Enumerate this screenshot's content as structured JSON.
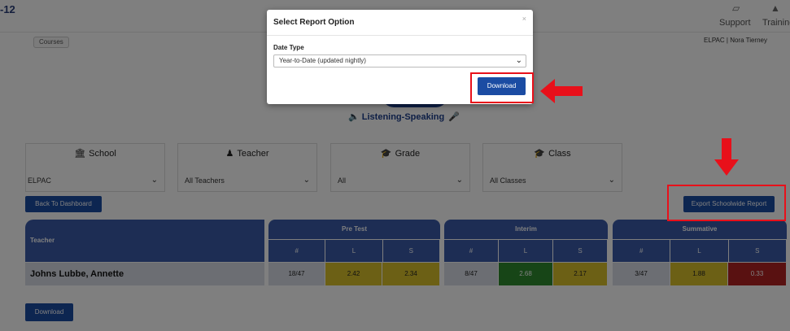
{
  "header": {
    "brand": "-12",
    "support_label": "Support",
    "training_label": "Training"
  },
  "breadcrumb": "Courses",
  "user_info": "ELPAC | Nora Tierney",
  "banner": {
    "title": "Listening-Speaking"
  },
  "filters": [
    {
      "title": "School",
      "value": "ELPAC"
    },
    {
      "title": "Teacher",
      "value": "All Teachers"
    },
    {
      "title": "Grade",
      "value": "All"
    },
    {
      "title": "Class",
      "value": "All Classes"
    }
  ],
  "buttons": {
    "back": "Back To Dashboard",
    "export": "Export Schoolwide Report",
    "download": "Download"
  },
  "table": {
    "teacher_header": "Teacher",
    "groups": [
      {
        "title": "Pre Test",
        "cols": [
          "#",
          "L",
          "S"
        ]
      },
      {
        "title": "Interim",
        "cols": [
          "#",
          "L",
          "S"
        ]
      },
      {
        "title": "Summative",
        "cols": [
          "#",
          "L",
          "S"
        ]
      }
    ],
    "rows": [
      {
        "teacher": "Johns Lubbe, Annette",
        "cells": [
          "18/47",
          "2.42",
          "2.34",
          "8/47",
          "2.68",
          "2.17",
          "3/47",
          "1.88",
          "0.33"
        ]
      }
    ]
  },
  "modal": {
    "title": "Select Report Option",
    "close": "×",
    "date_type_label": "Date Type",
    "date_type_value": "Year-to-Date (updated nightly)",
    "download_label": "Download"
  },
  "colors": {
    "primary": "#1b4ca3",
    "header_blue": "#3a5ba8",
    "yellow_cell": "#d8c02a",
    "green_cell": "#2e8b2e",
    "red_cell": "#b22222",
    "annotation_red": "#e8101a"
  }
}
